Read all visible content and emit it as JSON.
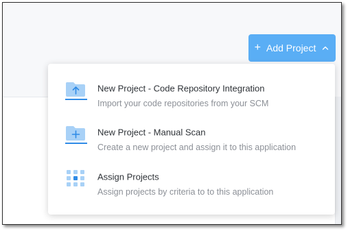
{
  "header": {
    "add_button": {
      "label": "Add Project",
      "plus_icon": "+",
      "chevron_icon": "chevron-up-icon"
    }
  },
  "menu": {
    "items": [
      {
        "title": "New Project - Code Repository Integration",
        "description": "Import your code repositories from your SCM",
        "icon": "folder-upload-icon"
      },
      {
        "title": "New Project - Manual Scan",
        "description": "Create a new project and assign it to this application",
        "icon": "folder-add-icon"
      },
      {
        "title": "Assign Projects",
        "description": "Assign projects by criteria to to this application",
        "icon": "grid-dots-icon"
      }
    ]
  },
  "colors": {
    "accent": "#5aaef5",
    "icon_light": "#a8d1f7",
    "icon_dark": "#2f8be6",
    "title_text": "#2f3338",
    "desc_text": "#8c9097"
  }
}
